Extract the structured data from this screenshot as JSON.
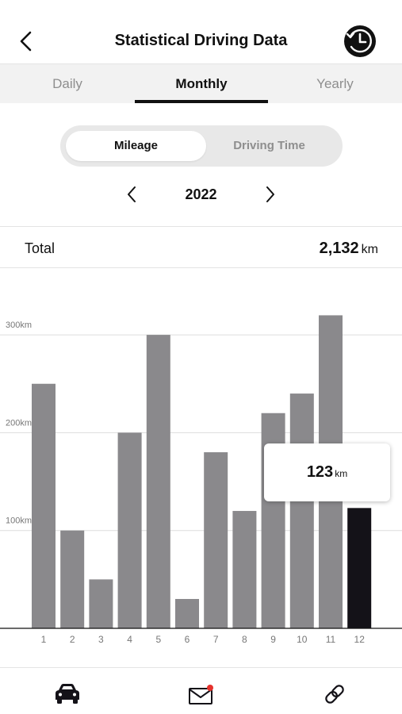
{
  "header": {
    "title": "Statistical Driving Data",
    "back_icon": "chevron-left-icon",
    "history_icon": "clock-history-icon"
  },
  "tabs": [
    {
      "label": "Daily",
      "active": false
    },
    {
      "label": "Monthly",
      "active": true
    },
    {
      "label": "Yearly",
      "active": false
    }
  ],
  "segment": {
    "options": [
      {
        "label": "Mileage",
        "active": true
      },
      {
        "label": "Driving Time",
        "active": false
      }
    ]
  },
  "year_nav": {
    "year": "2022",
    "prev_icon": "chevron-left-icon",
    "next_icon": "chevron-right-icon"
  },
  "total": {
    "label": "Total",
    "value": "2,132",
    "unit": "km"
  },
  "tooltip": {
    "value": "123",
    "unit": "km"
  },
  "colors": {
    "bar": "#8a898c",
    "bar_selected": "#141218",
    "grid": "#dddddd",
    "axis": "#111111",
    "notification": "#e5322d"
  },
  "chart_data": {
    "type": "bar",
    "categories": [
      "1",
      "2",
      "3",
      "4",
      "5",
      "6",
      "7",
      "8",
      "9",
      "10",
      "11",
      "12"
    ],
    "values": [
      250,
      100,
      50,
      200,
      300,
      30,
      180,
      120,
      220,
      240,
      320,
      123
    ],
    "selected_index": 11,
    "ytick_labels": [
      "100km",
      "200km",
      "300km"
    ],
    "yticks": [
      100,
      200,
      300
    ],
    "ylim": [
      0,
      350
    ],
    "grid": true
  },
  "bottom_nav": [
    {
      "icon": "car-icon",
      "active": true
    },
    {
      "icon": "mail-icon",
      "badge": true
    },
    {
      "icon": "link-icon"
    }
  ]
}
